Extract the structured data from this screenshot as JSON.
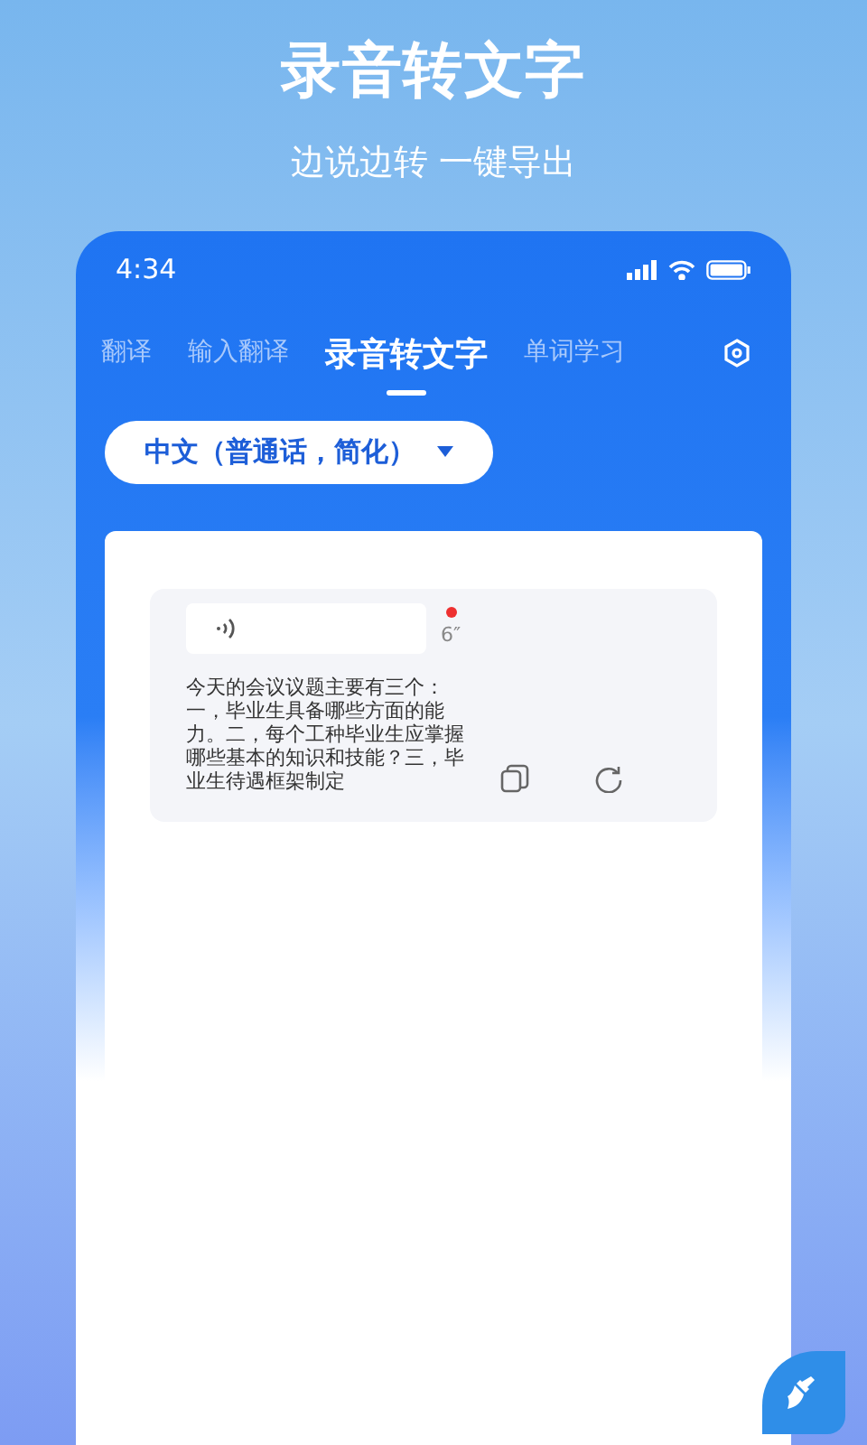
{
  "headline": "录音转文字",
  "subheadline": "边说边转 一键导出",
  "status_bar": {
    "time": "4:34"
  },
  "tabs": [
    {
      "label": "翻译",
      "selected": false
    },
    {
      "label": "输入翻译",
      "selected": false
    },
    {
      "label": "录音转文字",
      "selected": true
    },
    {
      "label": "单词学习",
      "selected": false
    }
  ],
  "language_select": {
    "value": "中文（普通话，简化）"
  },
  "records": [
    {
      "duration": "6″",
      "unread": true,
      "transcript": "今天的会议议题主要有三个：一，毕业生具备哪些方面的能力。二，每个工种毕业生应掌握哪些基本的知识和技能？三，毕业生待遇框架制定"
    }
  ]
}
